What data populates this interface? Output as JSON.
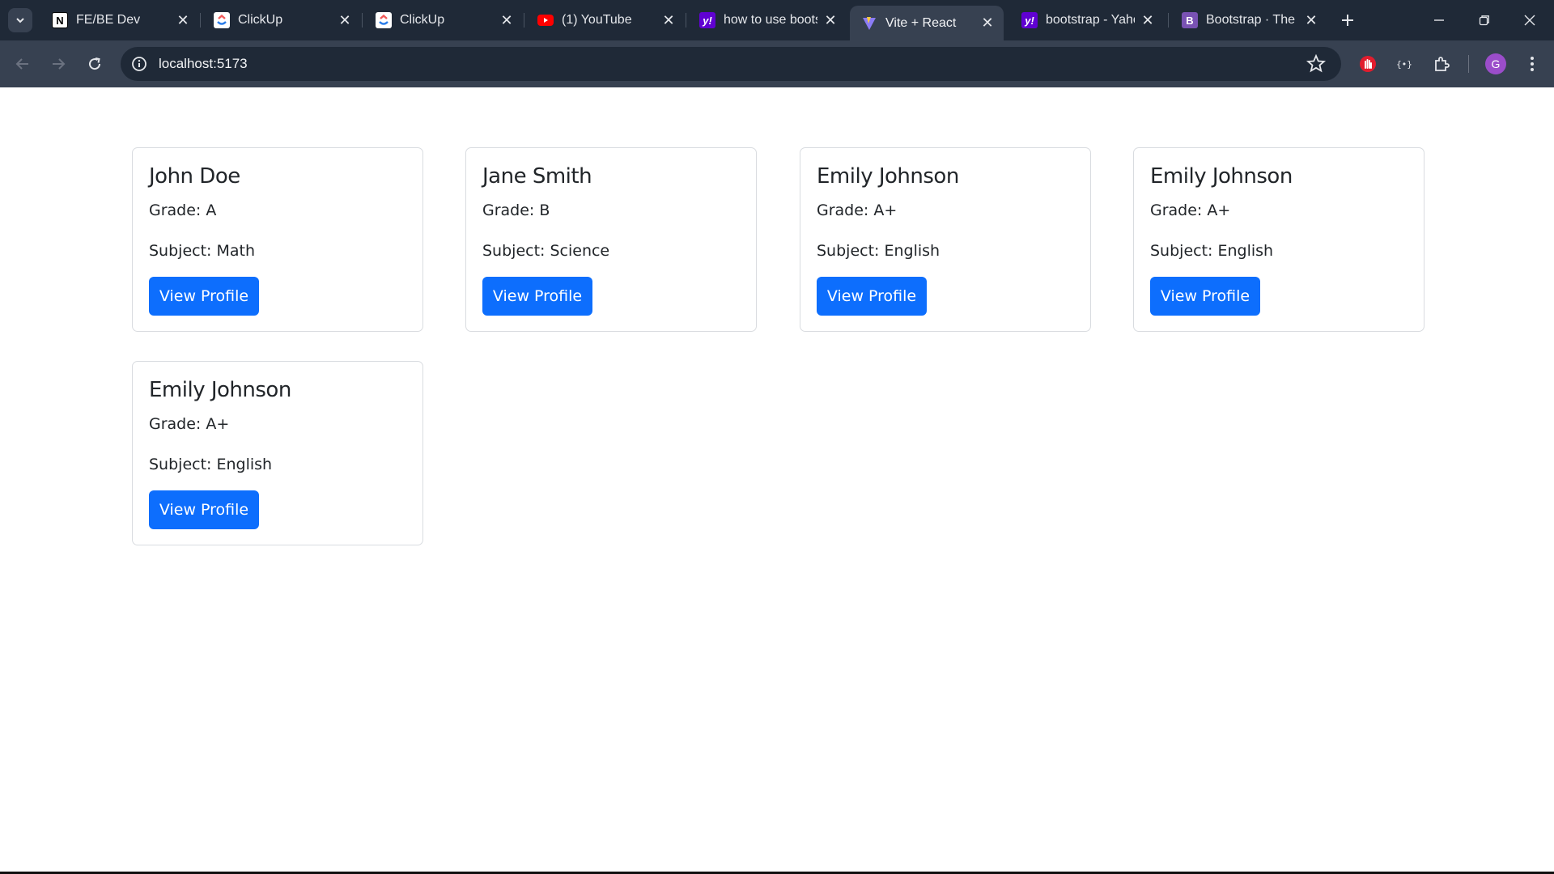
{
  "browser": {
    "tabs": [
      {
        "title": "FE/BE Dev",
        "icon": "notion-icon",
        "active": false
      },
      {
        "title": "ClickUp",
        "icon": "clickup-icon",
        "active": false
      },
      {
        "title": "ClickUp",
        "icon": "clickup-icon",
        "active": false
      },
      {
        "title": "(1) YouTube",
        "icon": "youtube-icon",
        "active": false
      },
      {
        "title": "how to use boots",
        "icon": "yahoo-icon",
        "active": false
      },
      {
        "title": "Vite + React",
        "icon": "vite-icon",
        "active": true
      },
      {
        "title": "bootstrap - Yaho",
        "icon": "yahoo-icon",
        "active": false
      },
      {
        "title": "Bootstrap · The m",
        "icon": "bootstrap-icon",
        "active": false
      }
    ],
    "url": "localhost:5173",
    "profile_initial": "G"
  },
  "students": [
    {
      "name": "John Doe",
      "grade": "Grade: A",
      "subject": "Subject: Math",
      "button": "View Profile"
    },
    {
      "name": "Jane Smith",
      "grade": "Grade: B",
      "subject": "Subject: Science",
      "button": "View Profile"
    },
    {
      "name": "Emily Johnson",
      "grade": "Grade: A+",
      "subject": "Subject: English",
      "button": "View Profile"
    },
    {
      "name": "Emily Johnson",
      "grade": "Grade: A+",
      "subject": "Subject: English",
      "button": "View Profile"
    },
    {
      "name": "Emily Johnson",
      "grade": "Grade: A+",
      "subject": "Subject: English",
      "button": "View Profile"
    }
  ],
  "colors": {
    "primary_button": "#0d6efd",
    "chrome_dark": "#1f2937",
    "chrome_toolbar": "#374151"
  }
}
